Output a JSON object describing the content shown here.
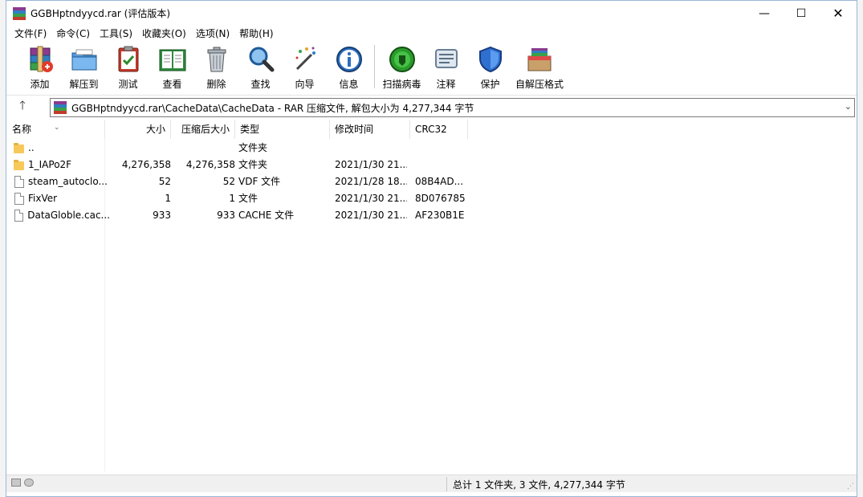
{
  "window": {
    "title": "GGBHptndyycd.rar (评估版本)",
    "min_glyph": "—",
    "max_glyph": "☐",
    "close_glyph": "✕"
  },
  "menu": [
    {
      "label": "文件(F)"
    },
    {
      "label": "命令(C)"
    },
    {
      "label": "工具(S)"
    },
    {
      "label": "收藏夹(O)"
    },
    {
      "label": "选项(N)"
    },
    {
      "label": "帮助(H)"
    }
  ],
  "toolbar": [
    {
      "label": "添加",
      "icon": "add-archive-icon"
    },
    {
      "label": "解压到",
      "icon": "extract-folder-icon"
    },
    {
      "label": "测试",
      "icon": "test-clipboard-icon"
    },
    {
      "label": "查看",
      "icon": "view-book-icon"
    },
    {
      "label": "删除",
      "icon": "trash-icon"
    },
    {
      "label": "查找",
      "icon": "magnifier-icon"
    },
    {
      "label": "向导",
      "icon": "wizard-wand-icon"
    },
    {
      "label": "信息",
      "icon": "info-icon"
    },
    {
      "label": "扫描病毒",
      "icon": "virus-scan-icon"
    },
    {
      "label": "注释",
      "icon": "comment-icon"
    },
    {
      "label": "保护",
      "icon": "shield-icon"
    },
    {
      "label": "自解压格式",
      "icon": "sfx-box-icon"
    }
  ],
  "address": {
    "up_glyph": "🡑",
    "path": "GGBHptndyycd.rar\\CacheData\\CacheData - RAR 压缩文件, 解包大小为 4,277,344 字节",
    "dropdown_glyph": "⌄"
  },
  "columns": {
    "name": "名称",
    "size": "大小",
    "packed": "压缩后大小",
    "type": "类型",
    "modified": "修改时间",
    "crc": "CRC32",
    "sort_glyph": "⌄"
  },
  "files": [
    {
      "kind": "folder",
      "name": "..",
      "size": "",
      "packed": "",
      "type": "文件夹",
      "modified": "",
      "crc": ""
    },
    {
      "kind": "folder",
      "name": "1_IAPo2F",
      "size": "4,276,358",
      "packed": "4,276,358",
      "type": "文件夹",
      "modified": "2021/1/30 21...",
      "crc": ""
    },
    {
      "kind": "file",
      "name": "steam_autoclo...",
      "size": "52",
      "packed": "52",
      "type": "VDF 文件",
      "modified": "2021/1/28 18...",
      "crc": "08B4AD..."
    },
    {
      "kind": "file",
      "name": "FixVer",
      "size": "1",
      "packed": "1",
      "type": "文件",
      "modified": "2021/1/30 21...",
      "crc": "8D076785"
    },
    {
      "kind": "file",
      "name": "DataGloble.cac...",
      "size": "933",
      "packed": "933",
      "type": "CACHE 文件",
      "modified": "2021/1/30 21...",
      "crc": "AF230B1E"
    }
  ],
  "status": {
    "text": "总计 1 文件夹, 3 文件, 4,277,344 字节",
    "grip": "⋰"
  },
  "colors": {
    "accent": "#0078d7",
    "folder": "#f7c95b",
    "border": "#9ab7d6"
  }
}
